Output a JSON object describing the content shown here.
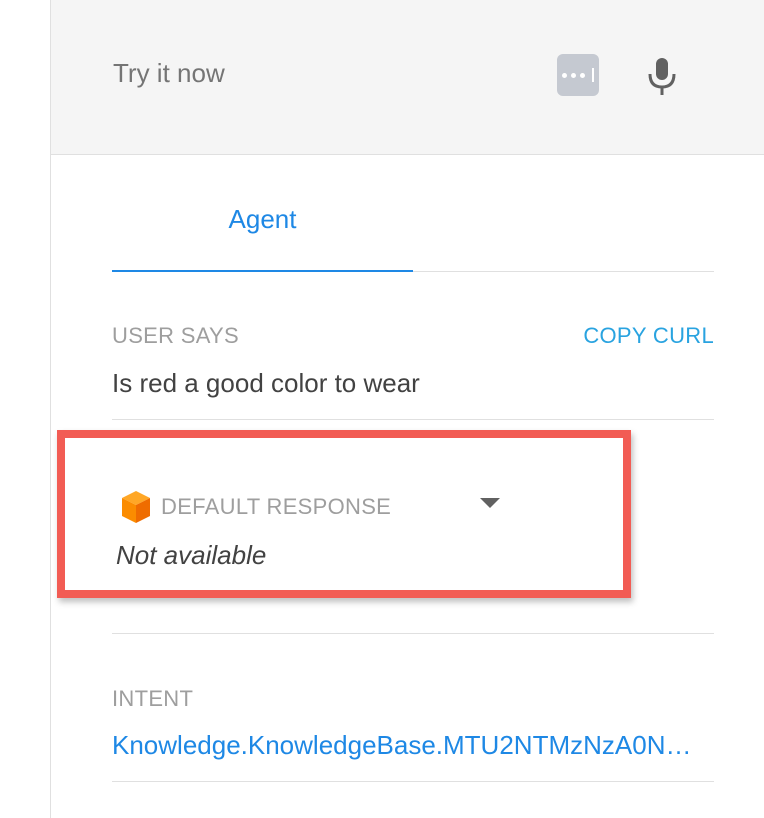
{
  "header": {
    "try_placeholder": "Try it now",
    "keyboard_icon": "keyboard-icon",
    "mic_icon": "microphone-icon"
  },
  "tabs": [
    {
      "label": "Agent",
      "active": true
    }
  ],
  "user_says": {
    "label": "USER SAYS",
    "copy_curl": "COPY CURL",
    "query": "Is red a good color to wear"
  },
  "response": {
    "label": "DEFAULT RESPONSE",
    "value": "Not available",
    "icon": "cube-icon"
  },
  "intent": {
    "label": "INTENT",
    "value": "Knowledge.KnowledgeBase.MTU2NTMzNzA0N…"
  },
  "colors": {
    "accent": "#1e88e5",
    "highlight": "#f25c54",
    "cube": "#f57c00"
  }
}
